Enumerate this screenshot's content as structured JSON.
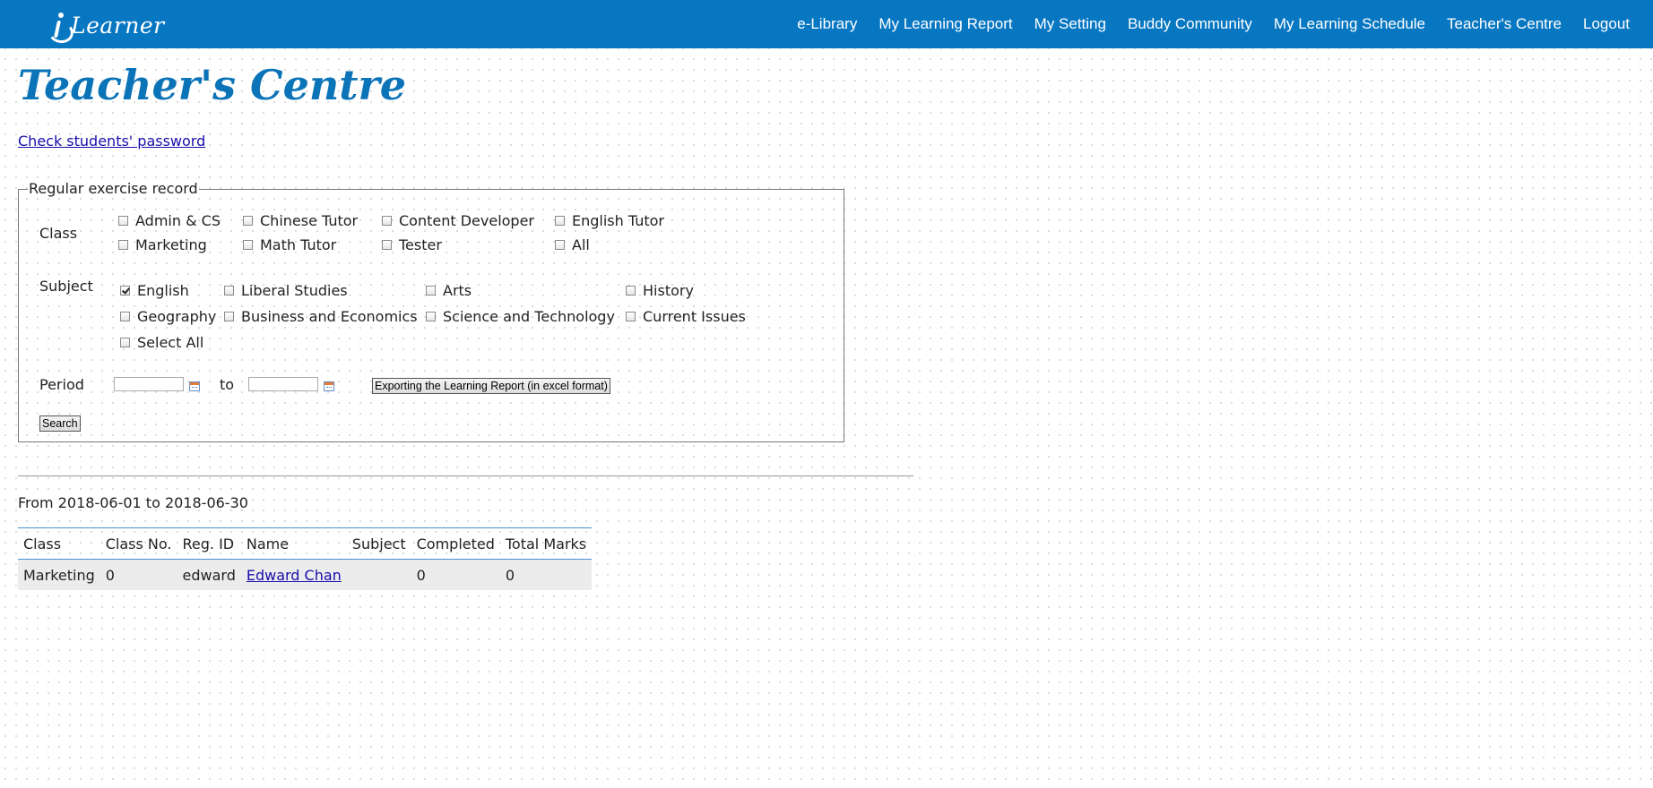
{
  "header": {
    "logo_text": "Learner",
    "nav": [
      {
        "label": "e-Library"
      },
      {
        "label": "My Learning Report"
      },
      {
        "label": "My Setting"
      },
      {
        "label": "Buddy Community"
      },
      {
        "label": "My Learning Schedule"
      },
      {
        "label": "Teacher's Centre"
      },
      {
        "label": "Logout"
      }
    ],
    "bar_color": "#0877c2"
  },
  "page": {
    "title": "Teacher's Centre",
    "password_link": "Check students' password"
  },
  "form": {
    "legend": "Regular exercise record",
    "class_label": "Class",
    "classes": [
      {
        "label": "Admin & CS",
        "checked": false
      },
      {
        "label": "Chinese Tutor",
        "checked": false
      },
      {
        "label": "Content Developer",
        "checked": false
      },
      {
        "label": "English Tutor",
        "checked": false
      },
      {
        "label": "Marketing",
        "checked": false
      },
      {
        "label": "Math Tutor",
        "checked": false
      },
      {
        "label": "Tester",
        "checked": false
      },
      {
        "label": "All",
        "checked": false
      }
    ],
    "subject_label": "Subject",
    "subjects": [
      {
        "label": "English",
        "checked": true
      },
      {
        "label": "Liberal Studies",
        "checked": false
      },
      {
        "label": "Arts",
        "checked": false
      },
      {
        "label": "History",
        "checked": false
      },
      {
        "label": "Geography",
        "checked": false
      },
      {
        "label": "Business and Economics",
        "checked": false
      },
      {
        "label": "Science and Technology",
        "checked": false
      },
      {
        "label": "Current Issues",
        "checked": false
      },
      {
        "label": "Select All",
        "checked": false
      }
    ],
    "period_label": "Period",
    "period_from": "",
    "period_to": "",
    "to_label": "to",
    "export_button": "Exporting the Learning Report (in excel format)",
    "search_button": "Search"
  },
  "results": {
    "period_text": "From 2018-06-01 to 2018-06-30",
    "columns": [
      "Class",
      "Class No.",
      "Reg. ID",
      "Name",
      "Subject",
      "Completed",
      "Total Marks"
    ],
    "rows": [
      {
        "class": "Marketing",
        "class_no": "0",
        "reg_id": "edward",
        "name": "Edward Chan",
        "subject": "",
        "completed": "0",
        "total_marks": "0"
      }
    ]
  }
}
